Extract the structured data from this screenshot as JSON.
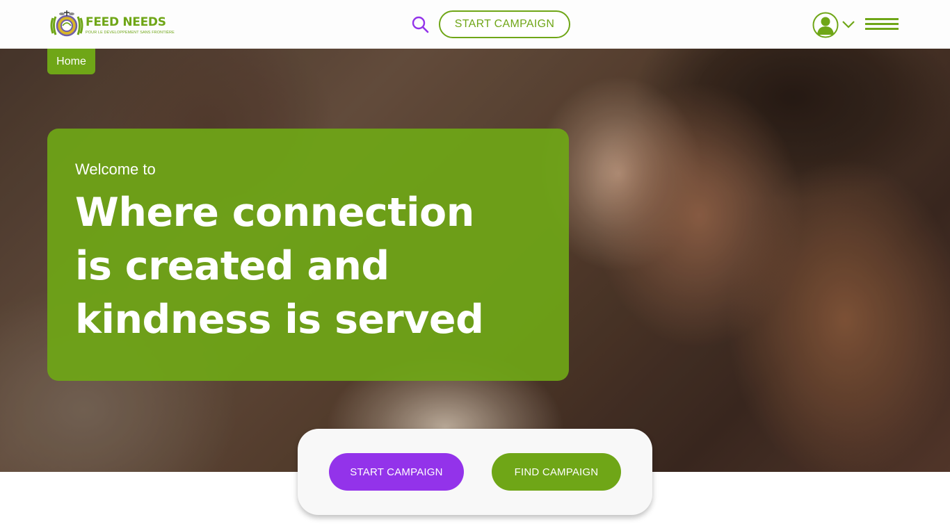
{
  "header": {
    "logo": {
      "title": "FEED NEEDS",
      "subtitle": "POUR LE DÉVELOPPEMENT SANS FRONTIÈRE",
      "icon": "globe-emblem-icon"
    },
    "search_icon": "search-icon",
    "start_campaign_label": "START CAMPAIGN",
    "avatar_icon": "user-avatar-icon",
    "dropdown_icon": "chevron-down-icon",
    "menu_icon": "hamburger-menu-icon"
  },
  "breadcrumb": {
    "home_label": "Home"
  },
  "hero": {
    "welcome": "Welcome to",
    "title_lines": [
      "Where connection",
      "is created and",
      "kindness is served"
    ]
  },
  "cta": {
    "start_label": "START CAMPAIGN",
    "find_label": "FIND CAMPAIGN"
  },
  "colors": {
    "brand_green": "#6fa617",
    "brand_purple": "#9333ea",
    "search_icon_color": "#9333ea",
    "white": "#ffffff"
  }
}
